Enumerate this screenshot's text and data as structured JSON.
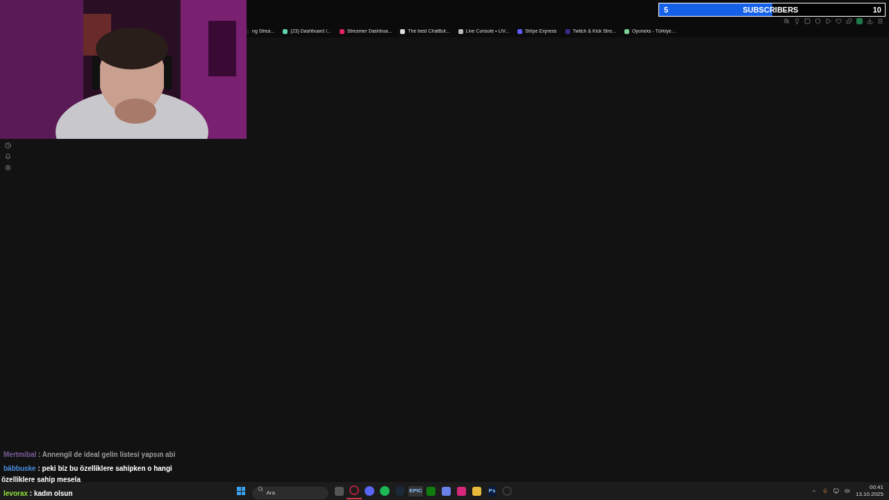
{
  "bookmarks": [
    {
      "label": "ng Strea...",
      "color": "#1a1a1a"
    },
    {
      "label": "(23) Dashboard /...",
      "color": "#5fd3b0"
    },
    {
      "label": "Streamer Dashboa...",
      "color": "#e0245e"
    },
    {
      "label": "The best ChatBot...",
      "color": "#dddddd"
    },
    {
      "label": "Live Console • LIV...",
      "color": "#bbbbbb"
    },
    {
      "label": "Stripe Express",
      "color": "#635bff"
    },
    {
      "label": "Twitch & Kick Stre...",
      "color": "#3a2a8a"
    },
    {
      "label": "Oyuneks - Türkiye...",
      "color": "#7fcf9a"
    }
  ],
  "subscriber_goal": {
    "current": "5",
    "label": "SUBSCRIBERS",
    "target": "10",
    "level": 0.5
  },
  "chat": [
    {
      "user": "Mertmibal",
      "separator": ":",
      "text": "Annengil de ideal gelin listesi yapsın abi",
      "color": "#7a5c9a",
      "faded": true
    },
    {
      "user": "bäbbuske",
      "separator": ":",
      "text": "peki biz bu özelliklere sahipken o hangi özelliklere sahip mesela",
      "color": "#4a8ee0",
      "faded": false
    },
    {
      "user": "levorax",
      "separator": ":",
      "text": "kadın olsun",
      "color": "#8ee03b",
      "faded": false
    }
  ],
  "taskbar": {
    "search_placeholder": "Ara",
    "apps": [
      {
        "color": "#555555",
        "kind": "square"
      },
      {
        "color": "#b0223a",
        "kind": "ring",
        "active": true
      },
      {
        "color": "#5865f2",
        "kind": "circle",
        "active": false
      },
      {
        "color": "#1db954",
        "kind": "circle",
        "active": false
      },
      {
        "color": "#1b2838",
        "kind": "circle",
        "active": false
      },
      {
        "color": "#333333",
        "kind": "label",
        "label": "EPIC",
        "active": false
      },
      {
        "color": "#107c10",
        "kind": "square",
        "active": false
      },
      {
        "color": "#6a7fe8",
        "kind": "square",
        "active": false
      },
      {
        "color": "#d6287a",
        "kind": "square",
        "active": false
      },
      {
        "color": "#e8b93a",
        "kind": "square",
        "active": false
      },
      {
        "color": "#0a1a3a",
        "kind": "label",
        "label": "Ps",
        "active": false
      },
      {
        "color": "#3a3a3a",
        "kind": "ring",
        "active": false
      }
    ],
    "time": "00:41",
    "date": "13.10.2025"
  }
}
